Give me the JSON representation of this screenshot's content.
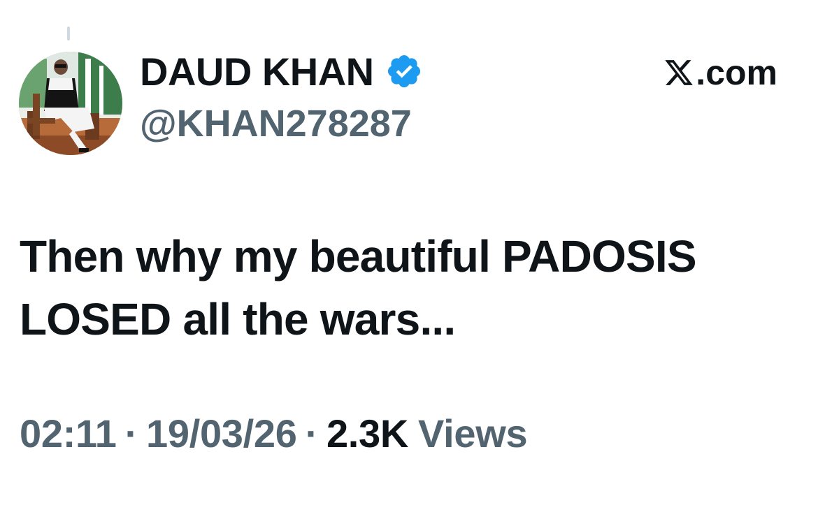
{
  "author": {
    "display_name": "DAUD KHAN",
    "handle": "@KHAN278287",
    "verified": true,
    "avatar_icon": "profile-photo"
  },
  "brand": {
    "text": ".com",
    "icon": "x-logo-icon"
  },
  "tweet": {
    "lines": [
      "Then why my beautiful PADOSIS",
      "LOSED all the wars..."
    ]
  },
  "meta": {
    "time": "02:11",
    "separator": "·",
    "date": "19/03/26",
    "views_count": "2.3K",
    "views_label": "Views"
  },
  "colors": {
    "text_primary": "#0f1419",
    "text_secondary": "#536471",
    "verified_blue": "#1d9bf0"
  }
}
